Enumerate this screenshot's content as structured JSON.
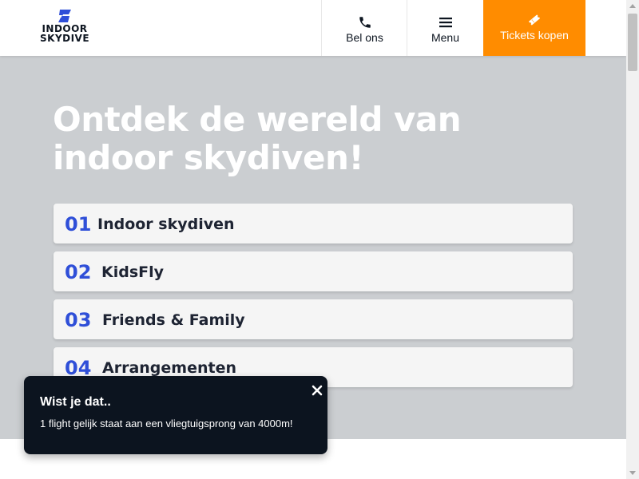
{
  "header": {
    "logo": {
      "line1": "INDOOR",
      "line2": "SKYDIVE",
      "icon": "skydive-logo-icon"
    },
    "call": {
      "label": "Bel ons",
      "icon": "phone-icon"
    },
    "menu": {
      "label": "Menu",
      "icon": "hamburger-menu-icon"
    },
    "tickets": {
      "label": "Tickets kopen",
      "icon": "ticket-icon"
    }
  },
  "hero": {
    "title_line1": "Ontdek de wereld van",
    "title_line2": "indoor skydiven!",
    "items": [
      {
        "number": "01",
        "label": "Indoor skydiven"
      },
      {
        "number": "02",
        "label": "KidsFly"
      },
      {
        "number": "03",
        "label": "Friends & Family"
      },
      {
        "number": "04",
        "label": "Arrangementen"
      }
    ]
  },
  "toast": {
    "title": "Wist je dat..",
    "body": "1 flight gelijk staat aan een vliegtuigsprong van 4000m!",
    "close_icon": "close-icon"
  },
  "colors": {
    "accent_orange": "#ff8c00",
    "number_blue": "#2f4fd8",
    "hero_bg": "#cbced1",
    "toast_bg": "#0c141f",
    "card_bg": "#f5f5f5",
    "dark_text": "#0d1520"
  }
}
